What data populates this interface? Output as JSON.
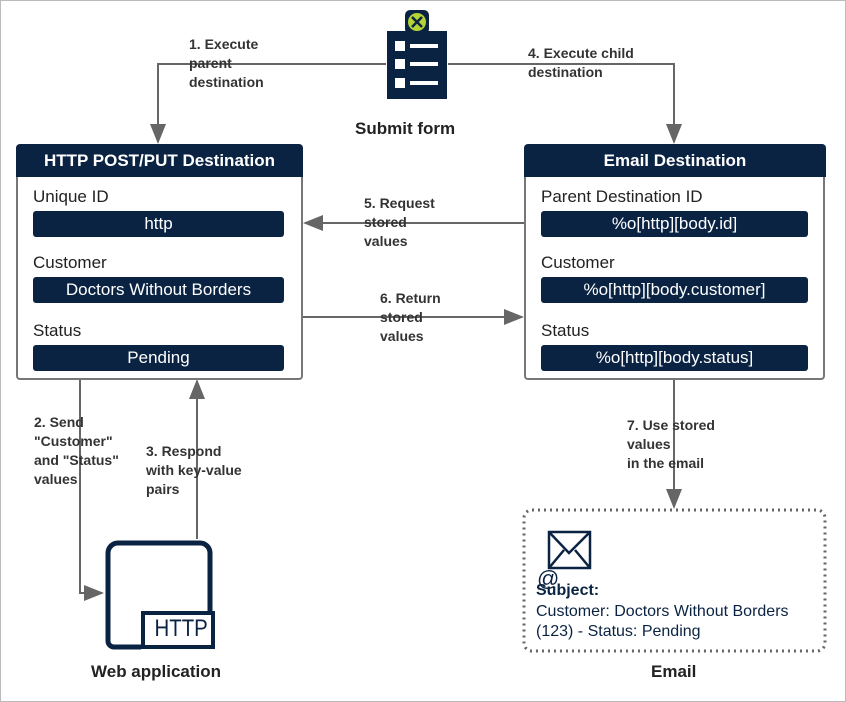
{
  "form": {
    "caption": "Submit form"
  },
  "steps": {
    "s1": "1. Execute\nparent\ndestination",
    "s2": "2. Send\n\"Customer\"\nand \"Status\"\nvalues",
    "s3": "3. Respond\nwith key-value\npairs",
    "s4": "4. Execute child\ndestination",
    "s5": "5. Request\nstored\nvalues",
    "s6": "6. Return\nstored\nvalues",
    "s7": "7. Use stored\nvalues\nin the email"
  },
  "http_dest": {
    "title": "HTTP POST/PUT Destination",
    "fields": [
      {
        "label": "Unique ID",
        "value": "http"
      },
      {
        "label": "Customer",
        "value": "Doctors Without Borders"
      },
      {
        "label": "Status",
        "value": "Pending"
      }
    ]
  },
  "email_dest": {
    "title": "Email Destination",
    "fields": [
      {
        "label": "Parent Destination ID",
        "value": "%o[http][body.id]"
      },
      {
        "label": "Customer",
        "value": "%o[http][body.customer]"
      },
      {
        "label": "Status",
        "value": "%o[http][body.status]"
      }
    ]
  },
  "webapp": {
    "caption": "Web application",
    "icon_text": "HTTP"
  },
  "email": {
    "caption": "Email",
    "subject_label": "Subject:",
    "subject_text": "Customer: Doctors Without Borders (123) - Status: Pending"
  },
  "colors": {
    "navy": "#0b2343",
    "accent": "#b5d334",
    "line": "#666666"
  }
}
